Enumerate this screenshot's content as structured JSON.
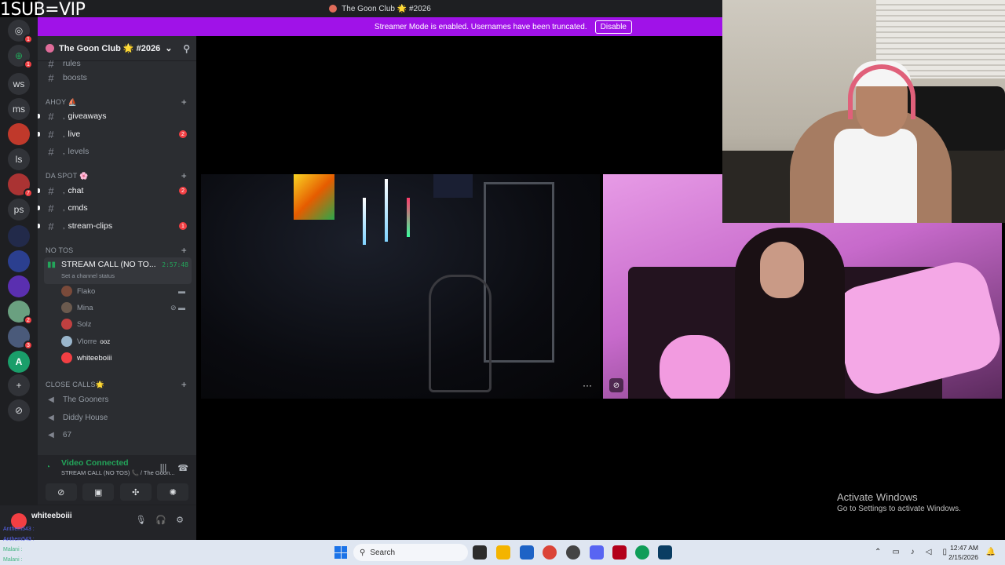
{
  "overlay": {
    "sub_text": "1SUB=VIP"
  },
  "titlebar": {
    "title": "The Goon Club 🌟 #2026"
  },
  "banner": {
    "text": "Streamer Mode is enabled. Usernames have been truncated.",
    "button": "Disable"
  },
  "rail": {
    "items": [
      {
        "label": "",
        "icon": "discord-icon",
        "badge": "1"
      },
      {
        "label": "",
        "icon": "plus-circle-icon",
        "badge": "1"
      },
      {
        "label": "ws"
      },
      {
        "label": "ms"
      },
      {
        "label": ""
      },
      {
        "label": "ls"
      },
      {
        "label": "",
        "badge": "7"
      },
      {
        "label": "ps"
      },
      {
        "label": ""
      },
      {
        "label": ""
      },
      {
        "label": ""
      },
      {
        "label": "",
        "badge": "2"
      },
      {
        "label": "",
        "badge": "3"
      },
      {
        "label": "A"
      }
    ],
    "add_icon": "add-server-icon",
    "discover_icon": "compass-icon"
  },
  "server": {
    "name": "The Goon Club 🌟 #2026"
  },
  "sidebar": {
    "partial_channel": "rules",
    "channels_top": [
      {
        "name": "boosts"
      }
    ],
    "cat_ahoy": "AHOY ⛵",
    "ahoy_channels": [
      {
        "name": "giveaways",
        "unread": true
      },
      {
        "name": "live",
        "unread": true,
        "badge": "2"
      },
      {
        "name": "levels",
        "unread": false
      }
    ],
    "cat_daspot": "DA SPOT 🌸",
    "daspot_channels": [
      {
        "name": "chat",
        "unread": true,
        "badge": "2"
      },
      {
        "name": "cmds",
        "unread": true
      },
      {
        "name": "stream-clips",
        "unread": true,
        "badge": "1"
      }
    ],
    "cat_notos": "NO TOS",
    "voice_call": {
      "title": "STREAM CALL (NO TO...",
      "time": "2:57:48",
      "status": "Set a channel status"
    },
    "members": [
      {
        "name": "Flako",
        "color": "#7a4a3a"
      },
      {
        "name": "Mina",
        "color": "#6b5a4e"
      },
      {
        "name": "Solz",
        "color": "#c04040"
      },
      {
        "name": "Vlorre",
        "tag": "ooz",
        "color": "#9ab6cc"
      },
      {
        "name": "whiteeboiii",
        "color": "#f23f43"
      }
    ],
    "cat_closecalls": "CLOSE CALLS🌟",
    "voice_channels": [
      {
        "name": "The Gooners"
      },
      {
        "name": "Diddy House"
      },
      {
        "name": "67"
      }
    ]
  },
  "voice_panel": {
    "status": "Video Connected",
    "sub": "STREAM CALL (NO TOS) 📞 / The Goon..."
  },
  "user_panel": {
    "name": "whiteeboiii",
    "chat_lines": [
      "Anthem543 :",
      "Anthem543 :",
      "Malani :",
      "Malani :"
    ]
  },
  "activation": {
    "title": "Activate Windows",
    "sub": "Go to Settings to activate Windows."
  },
  "taskbar": {
    "search": "Search",
    "time": "12:47 AM",
    "date": "2/15/2026"
  }
}
